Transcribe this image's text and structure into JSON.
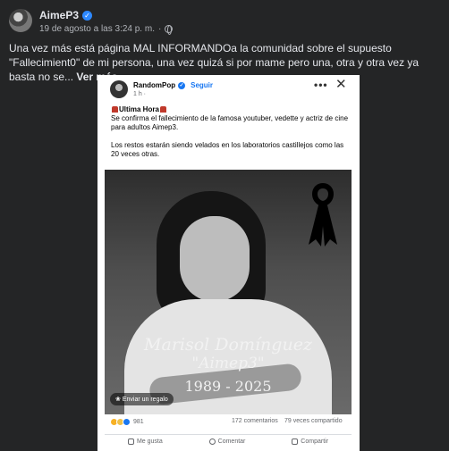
{
  "post": {
    "author": "AimeP3",
    "verified_icon": "verified-icon",
    "date": "19 de agosto a las 3:24 p. m.",
    "separator": "·",
    "text": "Una vez más está página MAL INFORMANDOa la comunidad sobre el supuesto \"Fallecimient0\" de mi persona, una vez quizá si por mame pero una, otra y otra vez ya basta no se...",
    "see_more": "Ver más"
  },
  "shared": {
    "page_name": "RandomPop",
    "follow": "Seguir",
    "time": "1 h ·",
    "more": "•••",
    "close": "✕",
    "headline": "Ultima Hora",
    "line1": "Se confirma el fallecimiento de la famosa youtuber, vedette y actriz de cine para adultos Aimep3.",
    "line2": "Los restos estarán siendo velados en los laboratorios castillejos como las 20 veces otras.",
    "image": {
      "name": "Marisol Domínguez",
      "alias": "\"Aimep3\"",
      "years": "1989 - 2025",
      "gift_button": "Enviar un regalo"
    },
    "reactions_count": "981",
    "comments": "172 comentarios",
    "shares": "79 veces compartido",
    "actions": {
      "like": "Me gusta",
      "comment": "Comentar",
      "share": "Compartir"
    }
  },
  "colors": {
    "background": "#242526",
    "accent": "#1877f2",
    "text": "#e4e6eb"
  }
}
